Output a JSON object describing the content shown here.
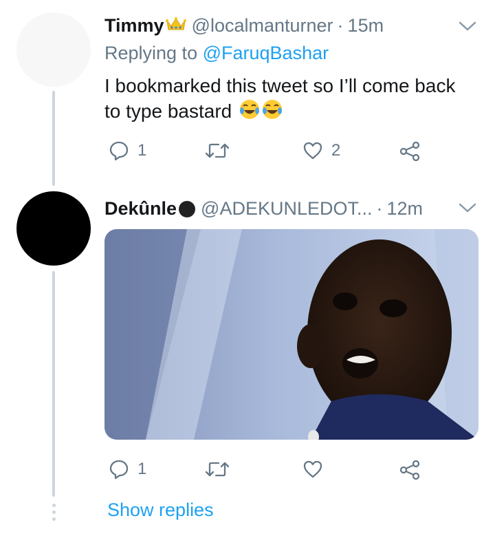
{
  "tweet1": {
    "name": "Timmy",
    "handle": "@localmanturner",
    "separator": "·",
    "time": "15m",
    "replying_prefix": "Replying to",
    "replying_to": "@FaruqBashar",
    "text": "I bookmarked this tweet so I’ll come back to type bastard",
    "reply_count": "1",
    "like_count": "2"
  },
  "tweet2": {
    "name": "Dekûnle",
    "handle": "@ADEKUNLEDOT...",
    "separator": "·",
    "time": "12m",
    "reply_count": "1"
  },
  "show_replies": "Show replies",
  "icons": {
    "verified_emoji": "crown-icon",
    "reply": "reply-icon",
    "retweet": "retweet-icon",
    "like": "heart-icon",
    "share": "share-icon",
    "menu": "chevron-down-icon"
  },
  "colors": {
    "link": "#1da1f2",
    "secondary_text": "#657786",
    "thread_line": "#ccd6dd"
  }
}
